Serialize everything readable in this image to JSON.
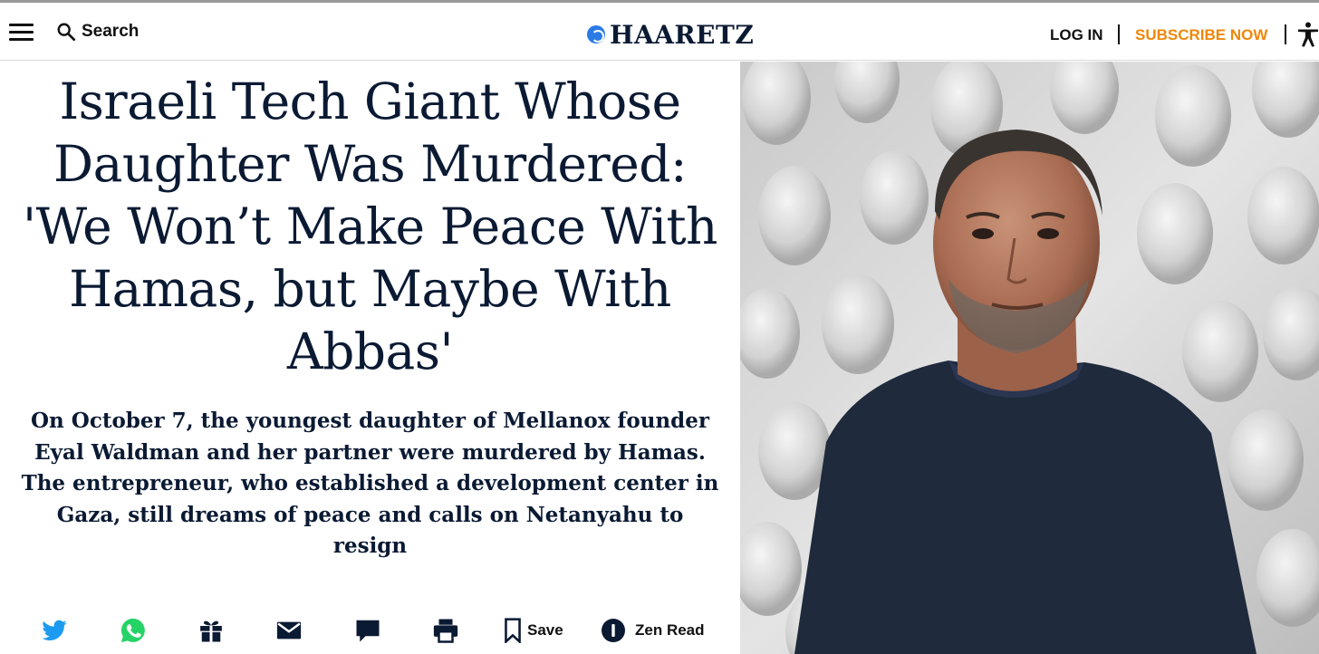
{
  "header": {
    "menu_icon": "hamburger-menu-icon",
    "search_label": "Search",
    "search_icon": "search-icon",
    "logo_text": "HAARETZ",
    "login_label": "LOG IN",
    "subscribe_label": "SUBSCRIBE NOW",
    "accessibility_icon": "accessibility-icon"
  },
  "article": {
    "headline": "Israeli Tech Giant Whose Daughter Was Murdered: 'We Won’t Make Peace With Hamas, but Maybe With Abbas'",
    "dek": "On October 7, the youngest daughter of Mellanox founder Eyal Waldman and her partner were murdered by Hamas. The entrepreneur, who established a development center in Gaza, still dreams of peace and calls on Netanyahu to resign"
  },
  "share_bar": {
    "icons": [
      "twitter-icon",
      "whatsapp-icon",
      "gift-icon",
      "email-icon",
      "comment-icon",
      "print-icon"
    ],
    "save_label": "Save",
    "zen_label": "Zen Read"
  },
  "photo": {
    "subject": "portrait-photo"
  },
  "colors": {
    "headline": "#0b1a33",
    "subscribe": "#f0870a",
    "twitter": "#1d9bf0",
    "whatsapp": "#25d366",
    "logo_badge": "#2c7be5"
  }
}
